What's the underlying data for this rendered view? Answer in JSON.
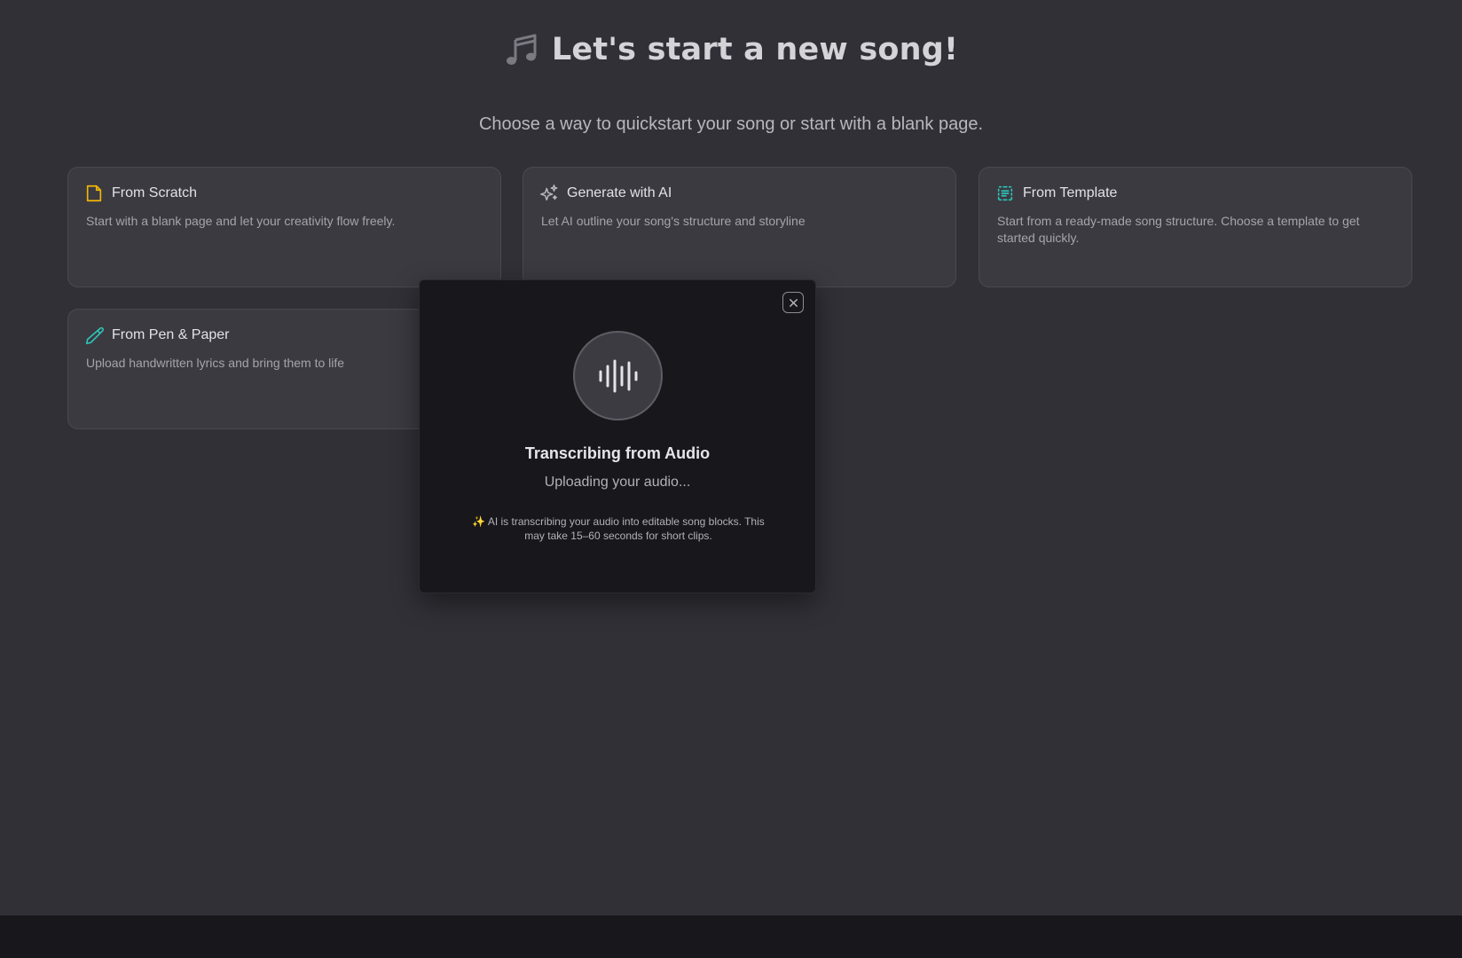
{
  "header": {
    "title": "Let's start a new song!",
    "icon": "music-notes-icon",
    "subtitle": "Choose a way to quickstart your song or start with a blank page."
  },
  "options": [
    {
      "title": "From Scratch",
      "desc": "Start with a blank page and let your creativity flow freely.",
      "icon": "blank-file-icon",
      "color": "#f2b705"
    },
    {
      "title": "Generate with AI",
      "desc": "Let AI outline your song's structure and storyline",
      "icon": "sparkles-icon",
      "color": "#b9b8be"
    },
    {
      "title": "From Template",
      "desc": "Start from a ready-made song structure. Choose a template to get started quickly.",
      "icon": "template-icon",
      "color": "#2ec4b6"
    },
    {
      "title": "From Pen & Paper",
      "desc": "Upload handwritten lyrics and bring them to life",
      "icon": "pen-icon",
      "color": "#2ec4b6"
    }
  ],
  "modal": {
    "title": "Transcribing from Audio",
    "status": "Uploading your audio...",
    "note_icon": "✨",
    "note": "AI is transcribing your audio into editable song blocks. This may take 15–60 seconds for short clips.",
    "icon": "audio-waveform-icon"
  }
}
